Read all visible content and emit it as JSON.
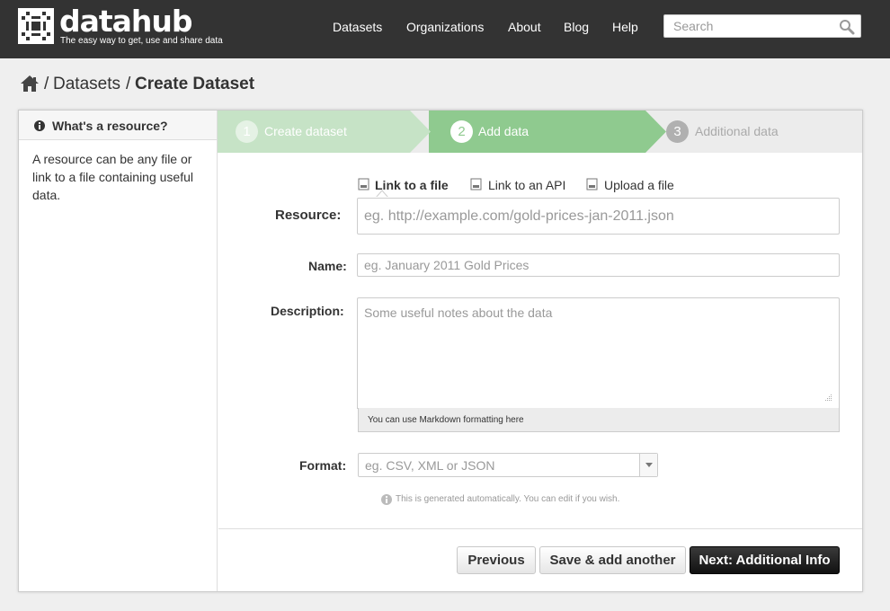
{
  "header": {
    "brand": "datahub",
    "tagline": "The easy way to get, use and share data",
    "nav": [
      "Datasets",
      "Organizations",
      "About",
      "Blog",
      "Help"
    ],
    "search_placeholder": "Search"
  },
  "breadcrumb": {
    "separator": "/",
    "items": [
      "Datasets"
    ],
    "current": "Create Dataset"
  },
  "aside": {
    "title": "What's a resource?",
    "text": "A resource can be any file or link to a file containing useful data."
  },
  "stages": [
    {
      "num": "1",
      "label": "Create dataset",
      "state": "complete"
    },
    {
      "num": "2",
      "label": "Add data",
      "state": "active"
    },
    {
      "num": "3",
      "label": "Additional data",
      "state": "inactive"
    }
  ],
  "resource_options": [
    "Link to a file",
    "Link to an API",
    "Upload a file"
  ],
  "form": {
    "resource_label": "Resource:",
    "resource_placeholder": "eg. http://example.com/gold-prices-jan-2011.json",
    "name_label": "Name:",
    "name_placeholder": "eg. January 2011 Gold Prices",
    "description_label": "Description:",
    "description_placeholder": "Some useful notes about the data",
    "markdown_note": "You can use Markdown formatting here",
    "format_label": "Format:",
    "format_placeholder": "eg. CSV, XML or JSON",
    "format_hint": "This is generated automatically. You can edit if you wish."
  },
  "actions": {
    "previous": "Previous",
    "save_another": "Save & add another",
    "next": "Next: Additional Info"
  },
  "colors": {
    "header_bg": "#333333",
    "stage_complete": "#c6e3c6",
    "stage_active": "#8fca8f",
    "stage_inactive": "#ececec"
  }
}
